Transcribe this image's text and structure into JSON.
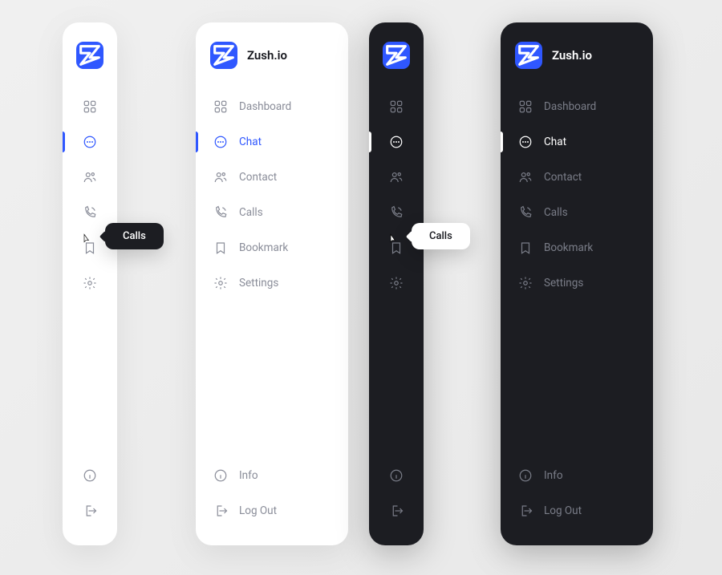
{
  "brand": {
    "name": "Zush.io"
  },
  "menu": {
    "dashboard": "Dashboard",
    "chat": "Chat",
    "contact": "Contact",
    "calls": "Calls",
    "bookmark": "Bookmark",
    "settings": "Settings"
  },
  "footer": {
    "info": "Info",
    "logout": "Log Out"
  },
  "tooltip": {
    "calls_dark": "Calls",
    "calls_light": "Calls"
  },
  "colors": {
    "accent": "#2f57ff",
    "dark_bg": "#1c1d22",
    "light_bg": "#ffffff"
  }
}
